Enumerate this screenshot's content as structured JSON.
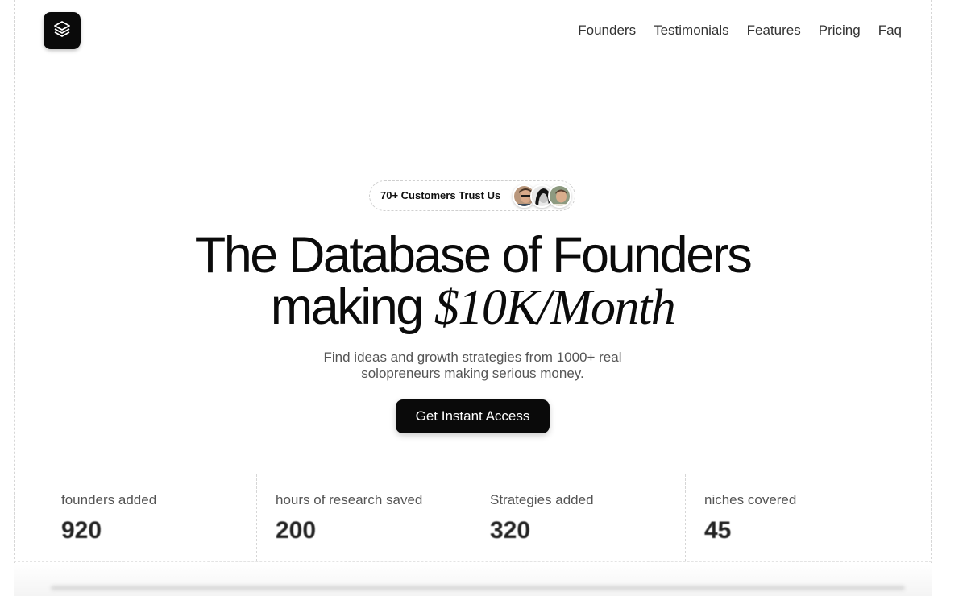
{
  "logo": {
    "icon": "layers-icon"
  },
  "nav": {
    "items": [
      {
        "label": "Founders"
      },
      {
        "label": "Testimonials"
      },
      {
        "label": "Features"
      },
      {
        "label": "Pricing"
      },
      {
        "label": "Faq"
      }
    ]
  },
  "hero": {
    "trust_badge": "70+ Customers Trust Us",
    "headline_line1": "The Database of Founders",
    "headline_line2_plain": "making",
    "headline_line2_italic": "$10K/Month",
    "subtext_line1": "Find ideas and growth strategies from 1000+ real",
    "subtext_line2": "solopreneurs making serious money.",
    "cta_label": "Get Instant Access"
  },
  "stats": [
    {
      "label": "founders added",
      "value": "920"
    },
    {
      "label": "hours of research saved",
      "value": "200"
    },
    {
      "label": "Strategies added",
      "value": "320"
    },
    {
      "label": "niches covered",
      "value": "45"
    }
  ],
  "colors": {
    "primary": "#0a0a0a",
    "text_muted": "#555555",
    "border_dashed": "#d6d6d6"
  }
}
